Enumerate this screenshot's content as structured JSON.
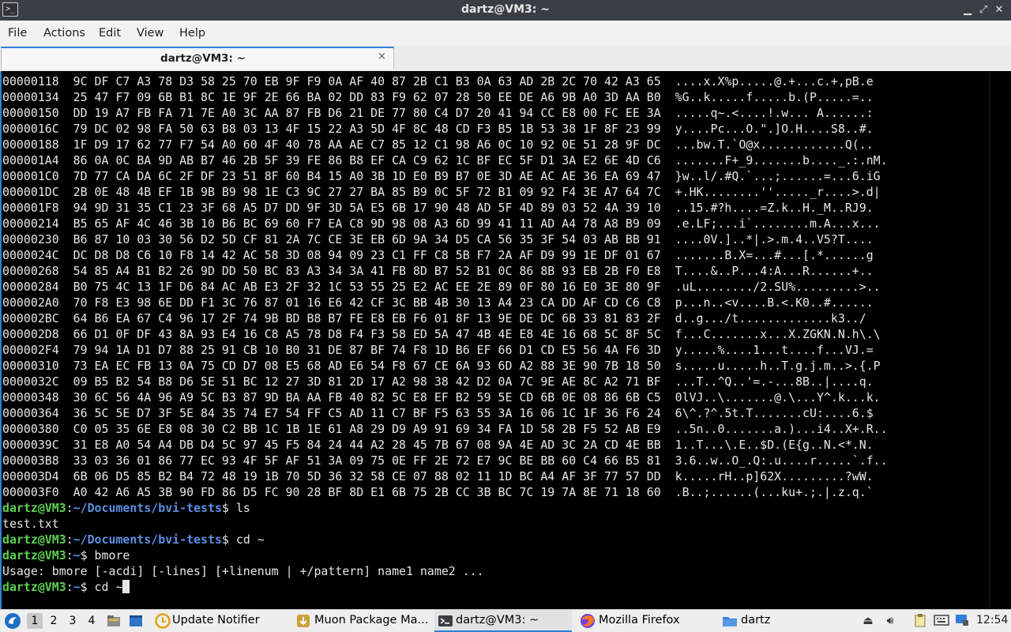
{
  "window": {
    "title": "dartz@VM3: ~",
    "app_icon": "terminal-icon",
    "controls": [
      "minimize",
      "maximize",
      "close"
    ]
  },
  "menu": {
    "items": [
      "File",
      "Actions",
      "Edit",
      "View",
      "Help"
    ]
  },
  "tab": {
    "label": "dartz@VM3: ~",
    "close_glyph": "×"
  },
  "terminal": {
    "hex_lines": [
      "00000118  9C DF C7 A3 78 D3 58 25 70 EB 9F F9 0A AF 40 87 2B C1 B3 0A 63 AD 2B 2C 70 42 A3 65  ....x.X%p.....@.+...c.+,pB.e",
      "00000134  25 47 F7 09 6B B1 8C 1E 9F 2E 66 BA 02 DD 83 F9 62 07 28 50 EE DE A6 9B A0 3D AA B0  %G..k.....f.....b.(P.....=..",
      "00000150  DD 19 A7 FB FA 71 7E A0 3C AA 87 FB D6 21 DE 77 80 C4 D7 20 41 94 CC E8 00 FC EE 3A  .....q~.<....!.w... A......:",
      "0000016C  79 DC 02 98 FA 50 63 B8 03 13 4F 15 22 A3 5D 4F 8C 48 CD F3 B5 1B 53 38 1F 8F 23 99  y....Pc...O.\".]O.H....S8..#.",
      "00000188  1F D9 17 62 77 F7 54 A0 60 4F 40 78 AA AE C7 85 12 C1 98 A6 0C 10 92 0E 51 28 9F DC  ...bw.T.`O@x............Q(..",
      "000001A4  86 0A 0C BA 9D AB B7 46 2B 5F 39 FE 86 B8 EF CA C9 62 1C BF EC 5F D1 3A E2 6E 4D C6  .......F+_9.......b...._.:.nM.",
      "000001C0  7D 77 CA DA 6C 2F DF 23 51 8F 60 B4 15 A0 3B 1D E0 B9 B7 0E 3D AE AC AE 36 EA 69 47  }w..l/.#Q.`...;......=...6.iG",
      "000001DC  2B 0E 48 4B EF 1B 9B B9 98 1E C3 9C 27 27 BA 85 B9 0C 5F 72 B1 09 92 F4 3E A7 64 7C  +.HK........''....._r....>.d|",
      "000001F8  94 9D 31 35 C1 23 3F 68 A5 D7 DD 9F 3D 5A E5 6B 17 90 48 AD 5F 4D 89 03 52 4A 39 10  ..15.#?h....=Z.k..H._M..RJ9.",
      "00000214  B5 65 AF 4C 46 3B 10 B6 BC 69 60 F7 EA C8 9D 98 08 A3 6D 99 41 11 AD A4 78 A8 B9 09  .e.LF;...i`........m.A...x...",
      "00000230  B6 87 10 03 30 56 D2 5D CF 81 2A 7C CE 3E EB 6D 9A 34 D5 CA 56 35 3F 54 03 AB BB 91  ....0V.]..*|.>.m.4..V5?T....",
      "0000024C  DC D8 D8 C6 10 F8 14 42 AC 58 3D 08 94 09 23 C1 FF C8 5B F7 2A AF D9 99 1E DF 01 67  .......B.X=...#...[.*......g",
      "00000268  54 85 A4 B1 B2 26 9D DD 50 BC 83 A3 34 3A 41 FB 8D B7 52 B1 0C 86 8B 93 EB 2B F0 E8  T....&..P...4:A...R......+..",
      "00000284  B0 75 4C 13 1F D6 84 AC AB E3 2F 32 1C 53 55 25 E2 AC EE 2E 89 0F 80 16 E0 3E 80 9F  .uL......../2.SU%.........>..",
      "000002A0  70 F8 E3 98 6E DD F1 3C 76 87 01 16 E6 42 CF 3C BB 4B 30 13 A4 23 CA DD AF CD C6 C8  p...n..<v....B.<.K0..#......",
      "000002BC  64 B6 EA 67 C4 96 17 2F 74 9B BD B8 B7 FE E8 EB F6 01 8F 13 9E DE DC 6B 33 81 83 2F  d..g.../t.............k3../",
      "000002D8  66 D1 0F DF 43 8A 93 E4 16 C8 A5 78 D8 F4 F3 58 ED 5A 47 4B 4E E8 4E 16 68 5C 8F 5C  f...C.......x...X.ZGKN.N.h\\.\\",
      "000002F4  79 94 1A D1 D7 88 25 91 CB 10 B0 31 DE 87 BF 74 F8 1D B6 EF 66 D1 CD E5 56 4A F6 3D  y.....%....1...t....f...VJ.=",
      "00000310  73 EA EC FB 13 0A 75 CD D7 08 E5 68 AD E6 54 F8 67 CE 6A 93 6D A2 88 3E 90 7B 18 50  s.....u.....h..T.g.j.m..>.{.P",
      "0000032C  09 B5 B2 54 B8 D6 5E 51 BC 12 27 3D 81 2D 17 A2 98 38 42 D2 0A 7C 9E AE 8C A2 71 BF  ...T..^Q..'=.-...8B..|....q.",
      "00000348  30 6C 56 4A 96 A9 5C B3 87 9D BA AA FB 40 82 5C E8 EF B2 59 5E CD 6B 0E 08 86 6B C5  0lVJ..\\.......@.\\...Y^.k...k.",
      "00000364  36 5C 5E D7 3F 5E 84 35 74 E7 54 FF C5 AD 11 C7 BF F5 63 55 3A 16 06 1C 1F 36 F6 24  6\\^.?^.5t.T.......cU:....6.$",
      "00000380  C0 05 35 6E E8 08 30 C2 BB 1C 1B 1E 61 A8 29 D9 A9 91 69 34 FA 1D 58 2B F5 52 AB E9  ..5n..0.......a.)...i4..X+.R..",
      "0000039C  31 E8 A0 54 A4 DB D4 5C 97 45 F5 84 24 44 A2 28 45 7B 67 08 9A 4E AD 3C 2A CD 4E BB  1..T...\\.E..$D.(E{g..N.<*.N.",
      "000003B8  33 03 36 01 86 77 EC 93 4F 5F AF 51 3A 09 75 0E FF 2E 72 E7 9C BE BB 60 C4 66 B5 81  3.6..w..O_.Q:.u....r.....`.f..",
      "000003D4  6B 06 D5 85 B2 B4 72 48 19 1B 70 5D 36 32 58 CE 07 88 02 11 1D BC A4 AF 3F 77 57 DD  k.....rH..p]62X.........?wW.",
      "000003F0  A0 42 A6 A5 3B 90 FD 86 D5 FC 90 28 BF 8D E1 6B 75 2B CC 3B BC 7C 19 7A 8E 71 18 60  .B..;......(...ku+.;.|.z.q.`"
    ],
    "session": [
      {
        "user": "dartz@VM3",
        "path": "~/Documents/bvi-tests",
        "sym": "$",
        "cmd": " ls"
      },
      {
        "output": "test.txt"
      },
      {
        "user": "dartz@VM3",
        "path": "~/Documents/bvi-tests",
        "sym": "$",
        "cmd": " cd ~"
      },
      {
        "user": "dartz@VM3",
        "path": "~",
        "sym": "$",
        "cmd": " bmore"
      },
      {
        "output": "Usage: bmore [-acdi] [-lines] [+linenum | +/pattern] name1 name2 ..."
      },
      {
        "user": "dartz@VM3",
        "path": "~",
        "sym": "$",
        "cmd": " cd ~",
        "cursor": true
      }
    ]
  },
  "taskbar": {
    "start_icon": "lubuntu-menu-icon",
    "desktops": [
      "1",
      "2",
      "3",
      "4"
    ],
    "active_desktop": "1",
    "quick_launch": [
      "file-manager-icon",
      "show-desktop-icon"
    ],
    "tasks": [
      {
        "label": "Update Notifier",
        "icon": "update-notifier-icon",
        "active": false
      },
      {
        "label": "Muon Package Ma...",
        "icon": "muon-package-icon",
        "active": false
      },
      {
        "label": "dartz@VM3: ~",
        "icon": "terminal-icon",
        "active": true
      },
      {
        "label": "Mozilla Firefox",
        "icon": "firefox-icon",
        "active": false
      },
      {
        "label": "dartz",
        "icon": "folder-icon",
        "active": false
      }
    ],
    "tray": [
      "eject-icon",
      "volume-icon",
      "clipboard-icon",
      "keyboard-icon",
      "network-icon"
    ],
    "clock": "12:54"
  }
}
